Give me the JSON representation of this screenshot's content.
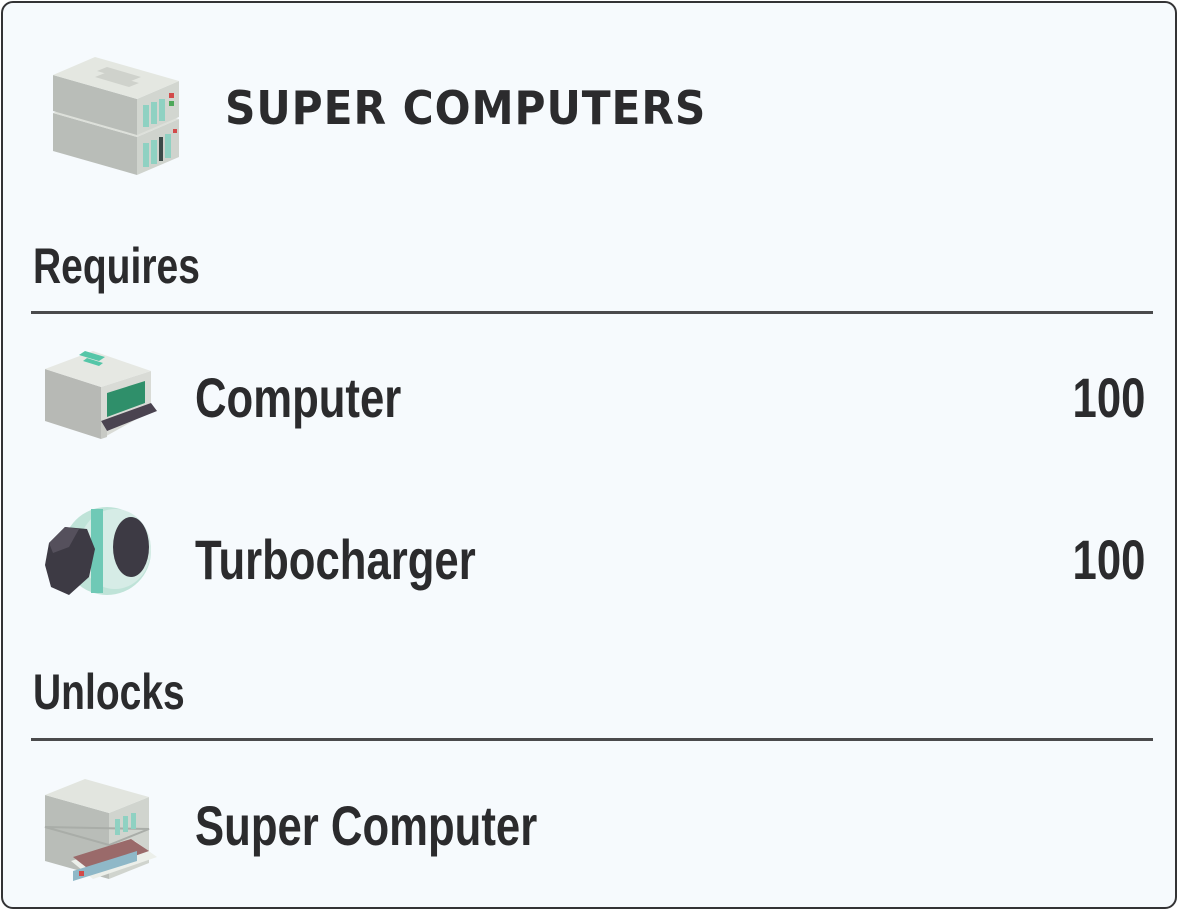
{
  "header": {
    "title": "SUPER COMPUTERS",
    "icon": "server-rack-icon"
  },
  "requires": {
    "heading": "Requires",
    "items": [
      {
        "label": "Computer",
        "quantity": "100",
        "icon": "computer-icon"
      },
      {
        "label": "Turbocharger",
        "quantity": "100",
        "icon": "turbocharger-icon"
      }
    ]
  },
  "unlocks": {
    "heading": "Unlocks",
    "items": [
      {
        "label": "Super Computer",
        "icon": "super-computer-icon"
      }
    ]
  },
  "colors": {
    "panel_background": "#f6fafd",
    "border": "#333335",
    "text": "#2b2b2d"
  }
}
